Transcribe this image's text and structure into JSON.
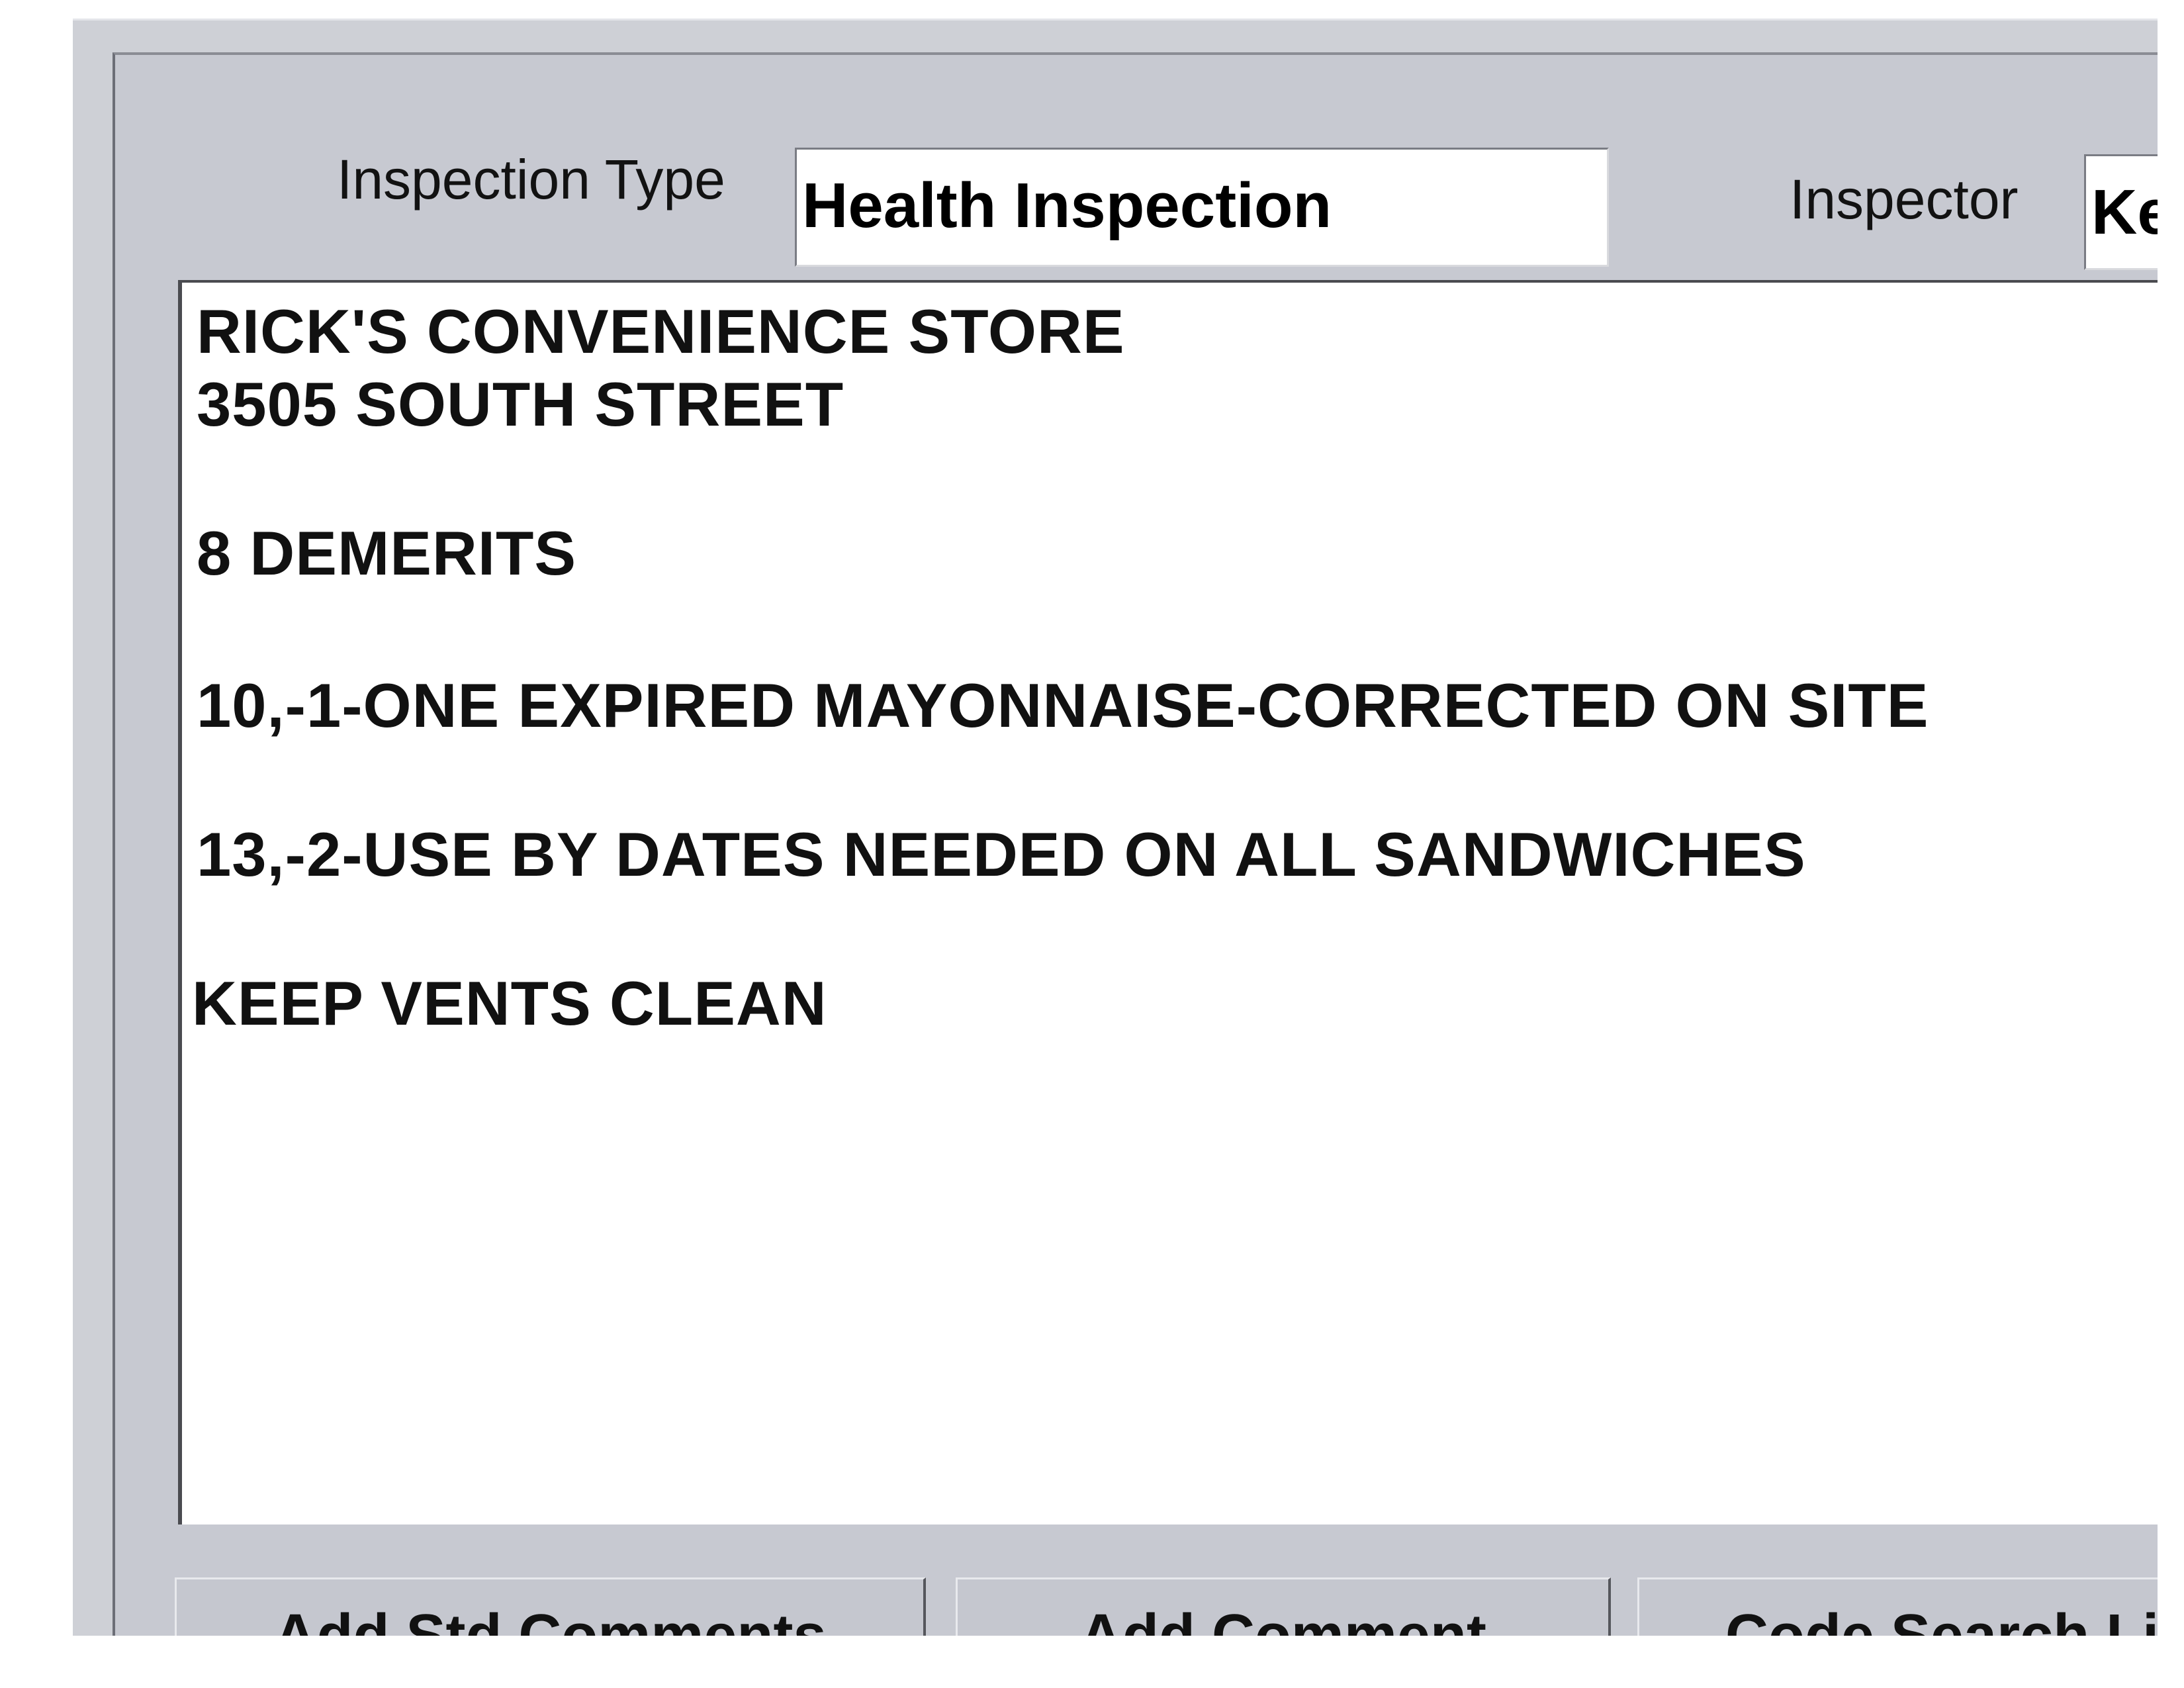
{
  "form": {
    "inspection_type_label": "Inspection Type",
    "inspection_type_value": "Health Inspection",
    "inspector_label": "Inspector",
    "inspector_value": "Ke"
  },
  "comments": [
    "RICK'S CONVENIENCE STORE",
    "3505 SOUTH STREET",
    "8 DEMERITS",
    "10,-1-ONE EXPIRED MAYONNAISE-CORRECTED ON SITE",
    "13,-2-USE BY DATES NEEDED ON ALL SANDWICHES",
    "KEEP VENTS CLEAN"
  ],
  "buttons": {
    "add_std_comments": {
      "pre": "Add ",
      "mnemonic": "S",
      "post": "td Comments"
    },
    "add_comment": {
      "pre": "",
      "mnemonic": "A",
      "post": "dd Comment"
    },
    "code_search": {
      "pre": "Code Search Li",
      "mnemonic": "",
      "post": ""
    }
  }
}
